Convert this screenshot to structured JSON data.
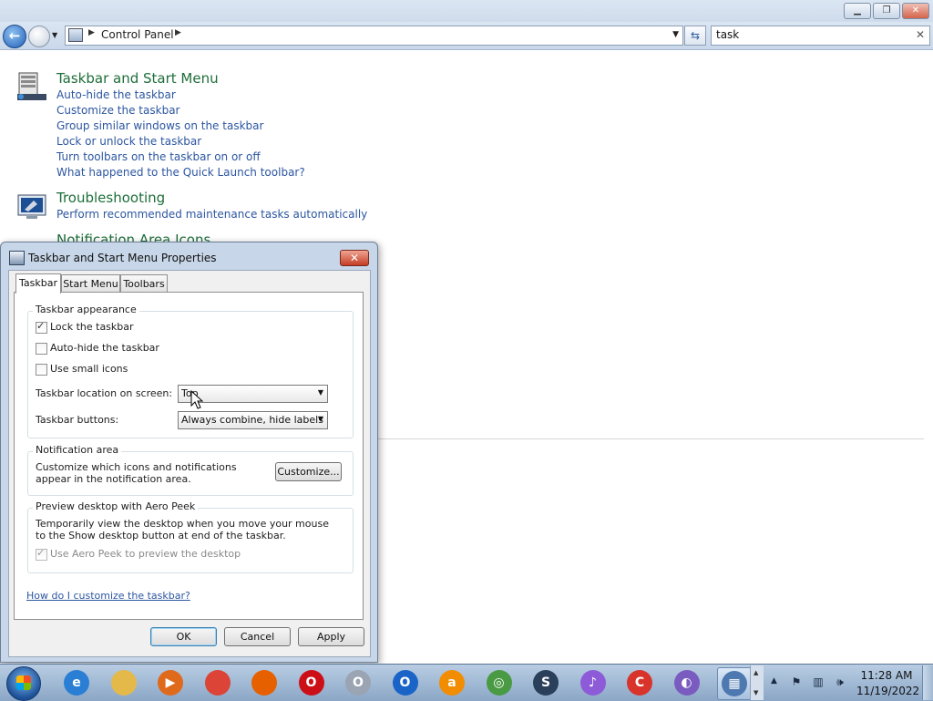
{
  "window": {
    "minimize_icon": "minimize-icon",
    "restore_icon": "restore-icon",
    "close_icon": "close-icon"
  },
  "nav": {
    "breadcrumb": "Control Panel",
    "search_value": "task"
  },
  "results": [
    {
      "title": "Taskbar and Start Menu",
      "icon": "taskbar-icon",
      "links": [
        "Auto-hide the taskbar",
        "Customize the taskbar",
        "Group similar windows on the taskbar",
        "Lock or unlock the taskbar",
        "Turn toolbars on the taskbar on or off",
        "What happened to the Quick Launch toolbar?"
      ]
    },
    {
      "title": "Troubleshooting",
      "icon": "troubleshooting-icon",
      "links": [
        "Perform recommended maintenance tasks automatically"
      ]
    },
    {
      "title": "Notification Area Icons",
      "icon": "notification-area-icon",
      "links": []
    }
  ],
  "dialog": {
    "title": "Taskbar and Start Menu Properties",
    "tabs": [
      "Taskbar",
      "Start Menu",
      "Toolbars"
    ],
    "active_tab": "Taskbar",
    "appearance": {
      "label": "Taskbar appearance",
      "lock": {
        "label": "Lock the taskbar",
        "checked": true
      },
      "autohide": {
        "label": "Auto-hide the taskbar",
        "checked": false
      },
      "small_icons": {
        "label": "Use small icons",
        "checked": false
      },
      "location_label": "Taskbar location on screen:",
      "location_value": "Top",
      "buttons_label": "Taskbar buttons:",
      "buttons_value": "Always combine, hide labels"
    },
    "notification": {
      "label": "Notification area",
      "text": "Customize which icons and notifications appear in the notification area.",
      "button": "Customize..."
    },
    "aero": {
      "label": "Preview desktop with Aero Peek",
      "text": "Temporarily view the desktop when you move your mouse to the Show desktop button at end of the taskbar.",
      "option": {
        "label": "Use Aero Peek to preview the desktop",
        "checked": true,
        "disabled": true
      }
    },
    "help_link": "How do I customize the taskbar?",
    "ok": "OK",
    "cancel": "Cancel",
    "apply": "Apply"
  },
  "taskbar": {
    "apps": [
      {
        "name": "internet-explorer",
        "glyph": "e",
        "color": "#2a7fd4"
      },
      {
        "name": "windows-explorer",
        "glyph": "",
        "color": "#e4b94a"
      },
      {
        "name": "media-player",
        "glyph": "▶",
        "color": "#e06a1b"
      },
      {
        "name": "chrome",
        "glyph": "",
        "color": "#db4437"
      },
      {
        "name": "firefox",
        "glyph": "",
        "color": "#e66000"
      },
      {
        "name": "opera",
        "glyph": "O",
        "color": "#cc0f16"
      },
      {
        "name": "opera-neon",
        "glyph": "O",
        "color": "#9aa4b2"
      },
      {
        "name": "opera-gx",
        "glyph": "O",
        "color": "#1a64c8"
      },
      {
        "name": "avast",
        "glyph": "a",
        "color": "#f28c00"
      },
      {
        "name": "globe-app",
        "glyph": "◎",
        "color": "#4a9a44"
      },
      {
        "name": "steam",
        "glyph": "S",
        "color": "#2a3f5a"
      },
      {
        "name": "itunes",
        "glyph": "♪",
        "color": "#8e5bd8"
      },
      {
        "name": "ccleaner",
        "glyph": "C",
        "color": "#d9342b"
      },
      {
        "name": "torrent",
        "glyph": "◐",
        "color": "#7a5cc0"
      },
      {
        "name": "control-panel",
        "glyph": "▦",
        "color": "#4d79b0"
      }
    ],
    "time": "11:28 AM",
    "date": "11/19/2022"
  }
}
